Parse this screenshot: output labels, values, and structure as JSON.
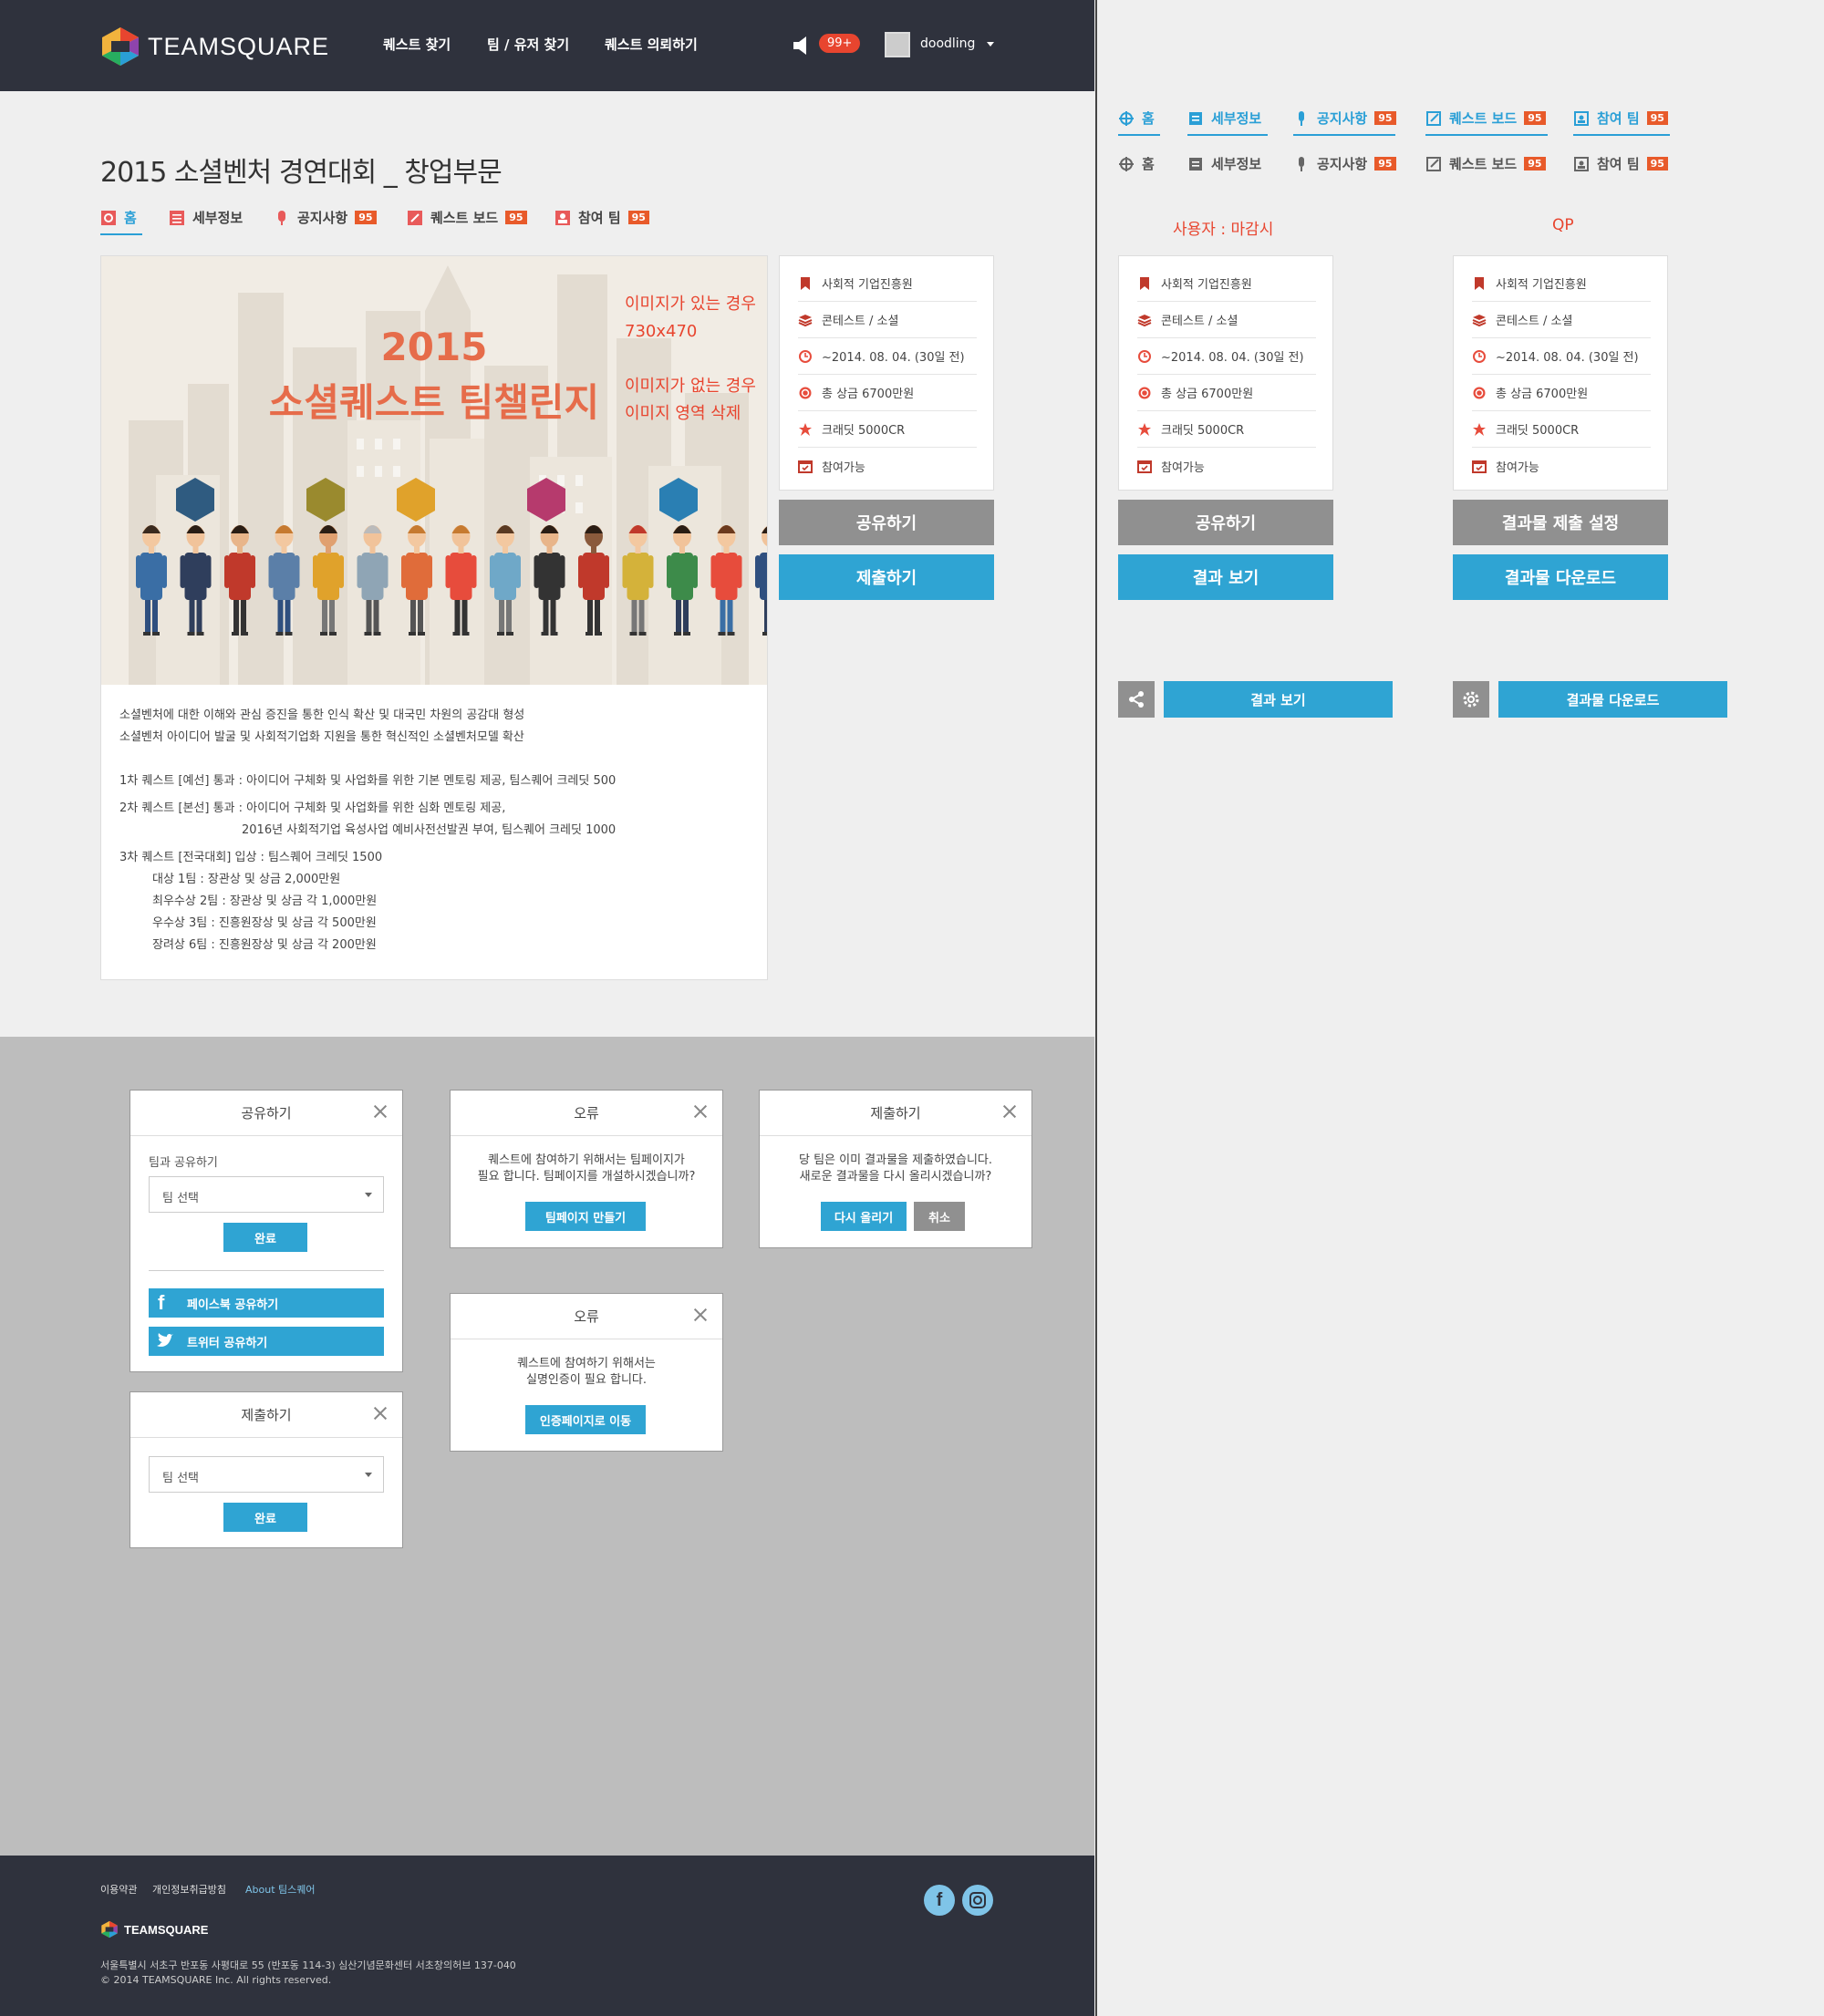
{
  "header": {
    "brand": "TEAMSQUARE",
    "nav": [
      "퀘스트 찾기",
      "팀 / 유저 찾기",
      "퀘스트 의뢰하기"
    ],
    "notif_count": "99+",
    "username": "doodling"
  },
  "page": {
    "title": "2015 소셜벤처 경연대회 _ 창업부문",
    "tabs": [
      {
        "label": "홈",
        "count": ""
      },
      {
        "label": "세부정보",
        "count": ""
      },
      {
        "label": "공지사항",
        "count": "95"
      },
      {
        "label": "퀘스트 보드",
        "count": "95"
      },
      {
        "label": "참여 팀",
        "count": "95"
      }
    ]
  },
  "hero": {
    "title_line1": "2015",
    "title_line2": "소셜퀘스트 팀챌린지",
    "note1_line1": "이미지가 있는 경우",
    "note1_line2": "730x470",
    "note2_line1": "이미지가 없는 경우",
    "note2_line2": "이미지 영역 삭제"
  },
  "description": [
    "소셜벤처에 대한 이해와 관심 증진을 통한 인식 확산 및 대국민 차원의 공감대 형성",
    "소셜벤처 아이디어 발굴 및 사회적기업화 지원을 통한 혁신적인 소셜벤처모델 확산",
    "1차 퀘스트 [예선] 통과 : 아이디어 구체화 및 사업화를 위한 기본 멘토링 제공, 팀스퀘어 크레딧 500",
    "2차 퀘스트 [본선] 통과 : 아이디어 구체화 및 사업화를 위한 심화 멘토링 제공,",
    "2016년 사회적기업 육성사업 예비사전선발권 부여, 팀스퀘어 크레딧 1000",
    "3차 퀘스트 [전국대회] 입상 : 팀스퀘어 크레딧 1500",
    "대상 1팀 : 장관상 및 상금 2,000만원",
    "최우수상 2팀 : 장관상 및 상금 각 1,000만원",
    "우수상 3팀 : 진흥원장상 및 상금 각 500만원",
    "장려상 6팀 : 진흥원장상 및 상금 각 200만원"
  ],
  "info": [
    "사회적 기업진흥원",
    "콘테스트 / 소셜",
    "~2014. 08. 04. (30일 전)",
    "총 상금 6700만원",
    "크래딧 5000CR",
    "참여가능"
  ],
  "buttons": {
    "share": "공유하기",
    "submit": "제출하기",
    "view_result": "결과 보기",
    "result_submit_setting": "결과물 제출 설정",
    "result_download": "결과물 다운로드"
  },
  "right": {
    "label_user": "사용자 : 마감시",
    "label_qp": "QP"
  },
  "modals": {
    "share": {
      "title": "공유하기",
      "label": "팀과 공유하기",
      "select": "팀 선택",
      "done": "완료",
      "facebook": "페이스북 공유하기",
      "twitter": "트위터 공유하기"
    },
    "submit": {
      "title": "제출하기",
      "select": "팀 선택",
      "done": "완료"
    },
    "error1": {
      "title": "오류",
      "line1": "퀘스트에 참여하기 위해서는 팀페이지가",
      "line2": "필요 합니다. 팀페이지를 개설하시겠습니까?",
      "button": "팀페이지 만들기"
    },
    "error2": {
      "title": "오류",
      "line1": "퀘스트에 참여하기 위해서는",
      "line2": "실명인증이 필요 합니다.",
      "button": "인증페이지로 이동"
    },
    "resubmit": {
      "title": "제출하기",
      "line1": "당 팀은 이미 결과물을 제출하였습니다.",
      "line2": "새로운 결과물을 다시 올리시겠습니까?",
      "retry": "다시 올리기",
      "cancel": "취소"
    }
  },
  "footer": {
    "links": [
      "이용약관",
      "개인정보취급방침",
      "About 팀스퀘어"
    ],
    "brand": "TEAMSQUARE",
    "address": "서울특별시 서초구 반포동 사평대로 55 (반포동 114-3) 심산기념문화센터 서초창의허브 137-040",
    "copyright": "© 2014 TEAMSQUARE Inc. All rights reserved."
  },
  "colors": {
    "accent": "#2fa4d3",
    "header": "#2f323d",
    "badge": "#e85a2a",
    "alert": "#e8452f",
    "gray_button": "#909090"
  }
}
